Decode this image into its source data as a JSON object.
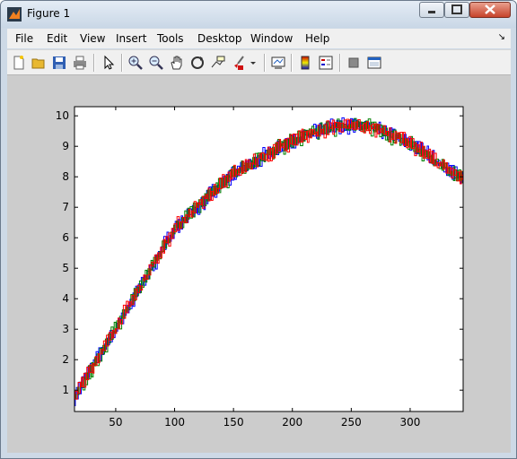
{
  "window": {
    "title": "Figure 1"
  },
  "menu": [
    "File",
    "Edit",
    "View",
    "Insert",
    "Tools",
    "Desktop",
    "Window",
    "Help"
  ],
  "toolbar_icons": [
    "new-figure-icon",
    "open-file-icon",
    "save-icon",
    "print-icon",
    "pointer-icon",
    "zoom-in-icon",
    "zoom-out-icon",
    "pan-icon",
    "rotate-icon",
    "data-cursor-icon",
    "brush-icon",
    "brush-dropdown-icon",
    "link-icon",
    "colorbar-icon",
    "legend-icon",
    "hide-tools-icon",
    "show-tools-icon"
  ],
  "colors": {
    "blue": "#0000ff",
    "green": "#008000",
    "red": "#ff0000"
  },
  "chart_data": {
    "type": "line",
    "style": "overlapping candlestick-like boxes in three colors following a rising then falling curve",
    "xlim": [
      15,
      345
    ],
    "ylim": [
      0.3,
      10.3
    ],
    "xticks": [
      50,
      100,
      150,
      200,
      250,
      300
    ],
    "yticks": [
      1,
      2,
      3,
      4,
      5,
      6,
      7,
      8,
      9,
      10
    ],
    "trend": {
      "x": [
        15,
        50,
        100,
        150,
        200,
        230,
        250,
        270,
        300,
        330,
        345
      ],
      "y": [
        0.8,
        3.0,
        6.3,
        8.1,
        9.2,
        9.6,
        9.7,
        9.6,
        9.1,
        8.3,
        7.9
      ]
    },
    "series": [
      {
        "color": "#0000ff"
      },
      {
        "color": "#008000"
      },
      {
        "color": "#ff0000"
      }
    ]
  }
}
